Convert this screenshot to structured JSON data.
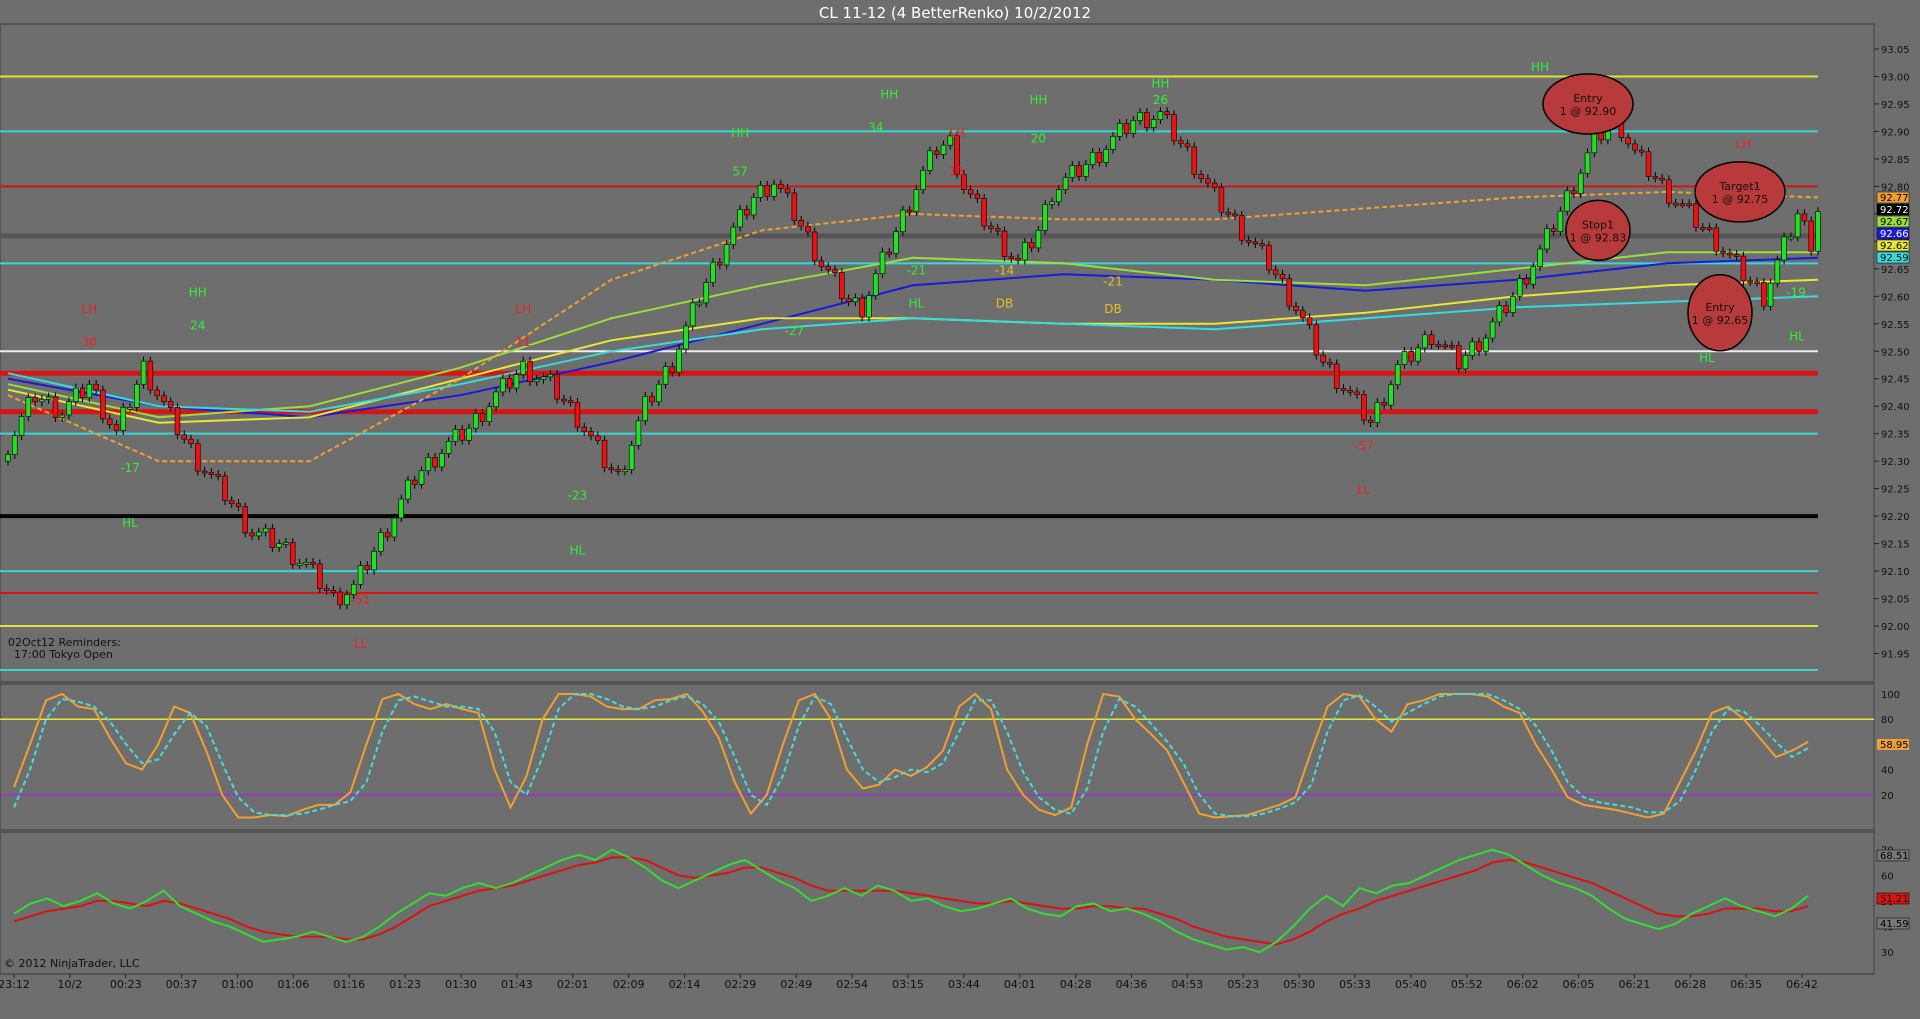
{
  "title": "CL 11-12 (4 BetterRenko)  10/2/2012",
  "copyright": "© 2012 NinjaTrader, LLC",
  "reminders": [
    "02Oct12 Reminders:",
    "17:00 Tokyo Open"
  ],
  "colors": {
    "background": "#6e6e6e",
    "up_bar": "#22e022",
    "down_bar": "#ee1111",
    "cyan": "#33dddd",
    "yellow": "#e8e833",
    "red_level": "#dd1111",
    "white_level": "#f4f4f4",
    "blue_ma": "#1a1adf",
    "lime_ma": "#9ade3a",
    "orange_ma": "#f0a030",
    "stoch_k": "#f0a030",
    "stoch_d": "#44dddd",
    "osc_fast": "#33dd33",
    "osc_slow": "#dd1111",
    "purple_line": "#9b30d8"
  },
  "chart_data": [
    {
      "type": "candlestick",
      "panel": "price",
      "x_labels": [
        "23:12",
        "10/2",
        "00:23",
        "00:37",
        "01:00",
        "01:06",
        "01:16",
        "01:23",
        "01:30",
        "01:43",
        "02:01",
        "02:09",
        "02:14",
        "02:29",
        "02:49",
        "02:54",
        "03:15",
        "03:44",
        "04:01",
        "04:28",
        "04:36",
        "04:53",
        "05:23",
        "05:30",
        "05:33",
        "05:40",
        "05:52",
        "06:02",
        "06:05",
        "06:21",
        "06:28",
        "06:35",
        "06:42"
      ],
      "y_ticks": [
        "93.05",
        "93.00",
        "92.95",
        "92.90",
        "92.85",
        "92.80",
        "92.75",
        "92.70",
        "92.65",
        "92.60",
        "92.55",
        "92.50",
        "92.45",
        "92.40",
        "92.35",
        "92.30",
        "92.25",
        "92.20",
        "92.15",
        "92.10",
        "92.05",
        "92.00",
        "91.95"
      ],
      "ylim": [
        91.92,
        93.07
      ],
      "bar_count": 154,
      "close_path": [
        [
          0,
          92.33
        ],
        [
          4,
          92.42
        ],
        [
          8,
          92.39
        ],
        [
          12,
          92.44
        ],
        [
          16,
          92.35
        ],
        [
          20,
          92.47
        ],
        [
          24,
          92.38
        ],
        [
          28,
          92.3
        ],
        [
          32,
          92.24
        ],
        [
          36,
          92.17
        ],
        [
          40,
          92.15
        ],
        [
          44,
          92.11
        ],
        [
          48,
          92.05
        ],
        [
          51,
          92.07
        ],
        [
          56,
          92.18
        ],
        [
          60,
          92.27
        ],
        [
          64,
          92.32
        ],
        [
          68,
          92.36
        ],
        [
          72,
          92.42
        ],
        [
          76,
          92.47
        ],
        [
          80,
          92.44
        ],
        [
          84,
          92.38
        ],
        [
          88,
          92.3
        ],
        [
          90,
          92.27
        ],
        [
          94,
          92.4
        ],
        [
          98,
          92.48
        ],
        [
          102,
          92.6
        ],
        [
          106,
          92.7
        ],
        [
          110,
          92.78
        ],
        [
          113,
          92.81
        ],
        [
          116,
          92.75
        ],
        [
          120,
          92.66
        ],
        [
          124,
          92.59
        ],
        [
          126,
          92.58
        ],
        [
          130,
          92.69
        ],
        [
          134,
          92.8
        ],
        [
          137,
          92.87
        ],
        [
          139,
          92.88
        ],
        [
          141,
          92.8
        ],
        [
          144,
          92.74
        ],
        [
          147,
          92.69
        ],
        [
          149,
          92.66
        ],
        [
          152,
          92.72
        ],
        [
          154,
          92.79
        ]
      ],
      "bars_ohlc_sample": [
        {
          "o": 92.33,
          "h": 92.37,
          "l": 92.29,
          "c": 92.37
        },
        {
          "o": 92.37,
          "h": 92.41,
          "l": 92.34,
          "c": 92.41
        }
      ],
      "moving_averages": [
        {
          "name": "",
          "color": "#1a1adf",
          "values": [
            92.45,
            92.4,
            92.38,
            92.42,
            92.48,
            92.55,
            92.62,
            92.64,
            92.63,
            92.61,
            92.63,
            92.66,
            92.67
          ]
        },
        {
          "name": "",
          "color": "#9ade3a",
          "values": [
            92.44,
            92.38,
            92.4,
            92.47,
            92.56,
            92.62,
            92.67,
            92.66,
            92.63,
            92.62,
            92.65,
            92.68,
            92.68
          ]
        },
        {
          "name": "",
          "color": "#e8e833",
          "values": [
            92.43,
            92.37,
            92.38,
            92.45,
            92.52,
            92.56,
            92.56,
            92.55,
            92.55,
            92.57,
            92.6,
            92.62,
            92.63
          ]
        },
        {
          "name": "",
          "color": "#33dddd",
          "values": [
            92.46,
            92.4,
            92.39,
            92.44,
            92.5,
            92.54,
            92.56,
            92.55,
            92.54,
            92.56,
            92.58,
            92.59,
            92.6
          ]
        },
        {
          "name": "",
          "color": "#f0a030",
          "dashed": true,
          "values": [
            92.42,
            92.3,
            92.3,
            92.45,
            92.63,
            92.72,
            92.75,
            92.74,
            92.74,
            92.76,
            92.78,
            92.79,
            92.78
          ]
        }
      ],
      "horizontal_levels": [
        {
          "price": 93.0,
          "color": "#e8e833"
        },
        {
          "price": 92.9,
          "color": "#33dddd"
        },
        {
          "price": 92.8,
          "color": "#dd1111"
        },
        {
          "price": 92.71,
          "color": "#555555"
        },
        {
          "price": 92.66,
          "color": "#33dddd"
        },
        {
          "price": 92.5,
          "color": "#f4f4f4"
        },
        {
          "price": 92.46,
          "color": "#dd1111"
        },
        {
          "price": 92.39,
          "color": "#dd1111"
        },
        {
          "price": 92.35,
          "color": "#33dddd"
        },
        {
          "price": 92.2,
          "color": "#000000"
        },
        {
          "price": 92.1,
          "color": "#33dddd"
        },
        {
          "price": 92.06,
          "color": "#dd1111"
        },
        {
          "price": 92.0,
          "color": "#e8e833"
        },
        {
          "price": 91.92,
          "color": "#33dddd"
        }
      ],
      "price_markers": [
        {
          "label": "92.77",
          "color": "#f0a030"
        },
        {
          "label": "92.72",
          "color": "#000000"
        },
        {
          "label": "92.67",
          "color": "#9ade3a"
        },
        {
          "label": "92.66",
          "color": "#1a1adf"
        },
        {
          "label": "92.62",
          "color": "#e8e833"
        },
        {
          "label": "92.59",
          "color": "#33dddd"
        }
      ],
      "annotations_green": [
        {
          "bar": 28,
          "text": "HH",
          "price": 92.6
        },
        {
          "bar": 28,
          "text": "24",
          "price": 92.54
        },
        {
          "bar": 18,
          "text": "-17",
          "price": 92.28
        },
        {
          "bar": 18,
          "text": "HL",
          "price": 92.18
        },
        {
          "bar": 84,
          "text": "-23",
          "price": 92.23
        },
        {
          "bar": 84,
          "text": "HL",
          "price": 92.13
        },
        {
          "bar": 108,
          "text": "HH",
          "price": 92.89
        },
        {
          "bar": 108,
          "text": "57",
          "price": 92.82
        },
        {
          "bar": 130,
          "text": "HH",
          "price": 92.96
        },
        {
          "bar": 128,
          "text": "34",
          "price": 92.9
        },
        {
          "bar": 116,
          "text": "-27",
          "price": 92.53
        },
        {
          "bar": 134,
          "text": "-21",
          "price": 92.64
        },
        {
          "bar": 134,
          "text": "HL",
          "price": 92.58
        },
        {
          "bar": 152,
          "text": "HH",
          "price": 92.95
        },
        {
          "bar": 152,
          "text": "20",
          "price": 92.88
        },
        {
          "bar": 170,
          "text": "HH",
          "price": 92.98
        },
        {
          "bar": 170,
          "text": "26",
          "price": 92.95
        },
        {
          "bar": 226,
          "text": "HH",
          "price": 93.01
        }
      ],
      "annotations_red": [
        {
          "bar": 12,
          "text": "LH",
          "price": 92.57
        },
        {
          "bar": 12,
          "text": "30",
          "price": 92.51
        },
        {
          "bar": 76,
          "text": "LH",
          "price": 92.57
        },
        {
          "bar": 76,
          "text": "11",
          "price": 92.51
        },
        {
          "bar": 140,
          "text": "LH",
          "price": 92.89
        },
        {
          "bar": 140,
          "text": "13",
          "price": 92.82
        },
        {
          "bar": 52,
          "text": "-51",
          "price": 92.04
        },
        {
          "bar": 52,
          "text": "LL",
          "price": 91.96
        },
        {
          "bar": 200,
          "text": "-57",
          "price": 92.32
        },
        {
          "bar": 200,
          "text": "LL",
          "price": 92.24
        },
        {
          "bar": 256,
          "text": "LH",
          "price": 92.87
        }
      ],
      "annotations_gold": [
        {
          "bar": 147,
          "text": "-14",
          "price": 92.64
        },
        {
          "bar": 147,
          "text": "DB",
          "price": 92.58
        },
        {
          "bar": 163,
          "text": "-21",
          "price": 92.62
        },
        {
          "bar": 163,
          "text": "DB",
          "price": 92.57
        }
      ],
      "trade_markers": [
        {
          "text": "Entry",
          "detail": "1 @ 92.90"
        },
        {
          "text": "Stop1",
          "detail": "1 @ 92.83"
        },
        {
          "text": "Target1",
          "detail": "1 @ 92.75"
        },
        {
          "text": "Entry",
          "detail": "1 @ 92.65"
        }
      ],
      "trade_tags_green": [
        "HL",
        "-19",
        "HL"
      ]
    },
    {
      "type": "line",
      "panel": "stochastics",
      "y_ticks": [
        "100",
        "80",
        "60",
        "40",
        "20"
      ],
      "ylim": [
        0,
        100
      ],
      "levels": [
        80,
        20
      ],
      "last_k_label": "58.95",
      "k": [
        26,
        60,
        95,
        100,
        90,
        88,
        65,
        45,
        40,
        60,
        90,
        85,
        55,
        20,
        2,
        2,
        4,
        3,
        8,
        12,
        12,
        22,
        60,
        96,
        100,
        92,
        88,
        92,
        88,
        85,
        40,
        10,
        35,
        80,
        100,
        100,
        98,
        90,
        88,
        88,
        95,
        96,
        100,
        86,
        65,
        30,
        5,
        20,
        60,
        95,
        100,
        80,
        40,
        25,
        28,
        40,
        35,
        42,
        55,
        90,
        100,
        88,
        40,
        20,
        8,
        4,
        10,
        60,
        100,
        98,
        80,
        68,
        55,
        30,
        5,
        2,
        3,
        4,
        8,
        12,
        18,
        55,
        90,
        100,
        98,
        80,
        70,
        92,
        95,
        100,
        100,
        100,
        98,
        90,
        85,
        60,
        40,
        18,
        12,
        10,
        8,
        5,
        2,
        5,
        30,
        55,
        85,
        90,
        80,
        65,
        50,
        55,
        62
      ],
      "d": [
        10,
        40,
        80,
        96,
        94,
        90,
        78,
        60,
        45,
        48,
        68,
        85,
        75,
        45,
        18,
        6,
        4,
        4,
        5,
        8,
        12,
        15,
        30,
        70,
        95,
        98,
        94,
        90,
        90,
        88,
        70,
        30,
        20,
        50,
        88,
        100,
        100,
        96,
        90,
        88,
        90,
        95,
        98,
        92,
        78,
        50,
        20,
        12,
        35,
        75,
        98,
        92,
        65,
        40,
        30,
        34,
        40,
        38,
        45,
        70,
        95,
        95,
        70,
        38,
        18,
        8,
        5,
        25,
        70,
        96,
        90,
        76,
        62,
        45,
        20,
        5,
        3,
        3,
        5,
        9,
        14,
        28,
        70,
        95,
        99,
        90,
        78,
        85,
        92,
        98,
        100,
        100,
        100,
        95,
        88,
        75,
        55,
        30,
        18,
        14,
        12,
        10,
        6,
        6,
        15,
        40,
        70,
        88,
        86,
        75,
        62,
        50,
        57
      ]
    },
    {
      "type": "line",
      "panel": "oscillator",
      "y_ticks": [
        "70",
        "60",
        "50",
        "40",
        "30"
      ],
      "ylim": [
        25,
        73
      ],
      "last_labels": [
        "68.51",
        "51.21",
        "41.59"
      ],
      "fast": [
        45,
        49,
        51,
        48,
        50,
        53,
        49,
        47,
        50,
        54,
        48,
        45,
        42,
        40,
        37,
        34,
        35,
        36,
        38,
        36,
        34,
        36,
        40,
        45,
        49,
        53,
        52,
        55,
        57,
        55,
        57,
        60,
        63,
        66,
        68,
        66,
        70,
        67,
        63,
        58,
        55,
        58,
        61,
        64,
        66,
        62,
        58,
        55,
        50,
        52,
        55,
        52,
        56,
        54,
        50,
        51,
        48,
        46,
        47,
        49,
        51,
        47,
        45,
        44,
        48,
        49,
        46,
        47,
        45,
        42,
        38,
        35,
        33,
        31,
        32,
        30,
        34,
        40,
        47,
        52,
        48,
        55,
        53,
        56,
        57,
        60,
        63,
        66,
        68,
        70,
        68,
        64,
        60,
        57,
        55,
        52,
        47,
        43,
        41,
        39,
        41,
        45,
        48,
        51,
        48,
        46,
        44,
        47,
        52
      ],
      "slow": [
        42,
        44,
        46,
        47,
        48,
        50,
        50,
        49,
        48,
        50,
        49,
        47,
        45,
        43,
        40,
        38,
        37,
        36,
        36,
        36,
        35,
        35,
        37,
        40,
        44,
        48,
        50,
        52,
        54,
        55,
        56,
        58,
        60,
        62,
        64,
        65,
        67,
        67,
        66,
        63,
        60,
        59,
        60,
        61,
        63,
        63,
        61,
        59,
        56,
        54,
        54,
        54,
        54,
        54,
        53,
        52,
        51,
        50,
        49,
        49,
        50,
        49,
        48,
        47,
        47,
        48,
        48,
        47,
        47,
        45,
        43,
        40,
        38,
        36,
        35,
        34,
        33,
        35,
        38,
        42,
        45,
        47,
        50,
        52,
        54,
        56,
        58,
        60,
        62,
        65,
        66,
        65,
        63,
        61,
        59,
        57,
        54,
        51,
        48,
        45,
        44,
        44,
        45,
        47,
        47,
        47,
        46,
        46,
        48
      ]
    }
  ]
}
